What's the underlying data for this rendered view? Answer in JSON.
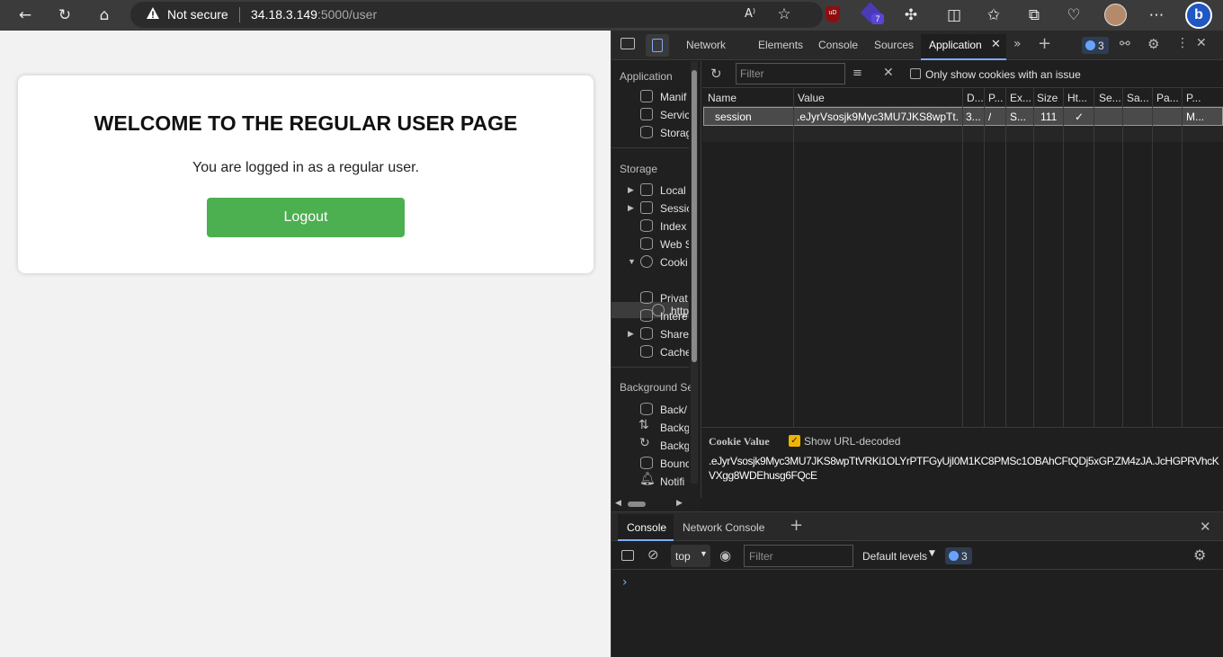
{
  "browser": {
    "security_label": "Not secure",
    "url_host": "34.18.3.149",
    "url_rest": ":5000/user",
    "extension_badge": "7"
  },
  "page": {
    "title": "WELCOME TO THE REGULAR USER PAGE",
    "message": "You are logged in as a regular user.",
    "logout_label": "Logout"
  },
  "devtools": {
    "tabs": {
      "network": "Network",
      "elements": "Elements",
      "console": "Console",
      "sources": "Sources",
      "application": "Application"
    },
    "issues_count": "3",
    "sidebar": {
      "application_header": "Application",
      "application_items": [
        "Manif",
        "Servic",
        "Storag"
      ],
      "storage_header": "Storage",
      "storage_items": [
        "Local",
        "Sessic",
        "Index",
        "Web S",
        "Cooki",
        "http",
        "Privat",
        "Intere",
        "Share",
        "Cache"
      ],
      "background_header": "Background Se",
      "background_items": [
        "Back/",
        "Backg",
        "Backg",
        "Bounc",
        "Notifi"
      ]
    },
    "cookies_toolbar": {
      "filter_placeholder": "Filter",
      "only_issue_label": "Only show cookies with an issue"
    },
    "cookie_table": {
      "headers": [
        "Name",
        "Value",
        "D...",
        "P...",
        "Ex...",
        "Size",
        "Ht...",
        "Se...",
        "Sa...",
        "Pa...",
        "P..."
      ],
      "rows": [
        {
          "name": "session",
          "value": ".eJyrVsosjk9Myc3MU7JKS8wpTt...",
          "domain": "3...",
          "path": "/",
          "expires": "S...",
          "size": "111",
          "httponly": "✓",
          "secure": "",
          "samesite": "",
          "partition": "",
          "priority": "M..."
        }
      ]
    },
    "cookie_value": {
      "label": "Cookie Value",
      "decode_label": "Show URL-decoded",
      "value": ".eJyrVsosjk9Myc3MU7JKS8wpTtVRKi1OLYrPTFGyUjI0M1KC8PMSc1OBAhCFtQDj5xGP.ZM4zJA.JcHGPRVhcKVXgg8WDEhusg6FQcE"
    },
    "drawer": {
      "tab_console": "Console",
      "tab_network_console": "Network Console",
      "context": "top",
      "filter_placeholder": "Filter",
      "levels": "Default levels",
      "issues_count": "3",
      "prompt": "›"
    }
  }
}
